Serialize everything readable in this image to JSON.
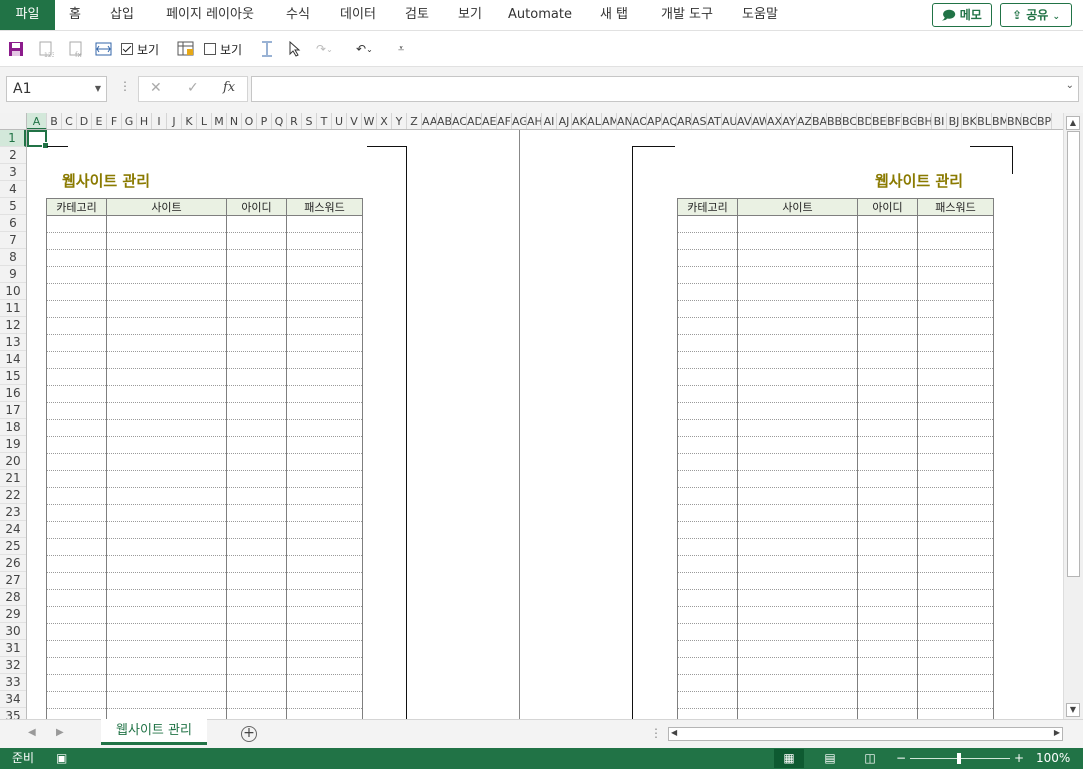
{
  "menu": {
    "tabs": [
      "파일",
      "홈",
      "삽입",
      "페이지 레이아웃",
      "수식",
      "데이터",
      "검토",
      "보기",
      "Automate",
      "새 탭",
      "개발 도구",
      "도움말"
    ],
    "memo_button": "메모",
    "share_button": "공유"
  },
  "quickbar": {
    "checkbox1_label": "보기",
    "checkbox1_checked": true,
    "checkbox2_label": "보기",
    "checkbox2_checked": false
  },
  "formula_bar": {
    "name_box": "A1",
    "formula_value": ""
  },
  "grid": {
    "column_headers": [
      "A",
      "B",
      "C",
      "D",
      "E",
      "F",
      "G",
      "H",
      "I",
      "J",
      "K",
      "L",
      "M",
      "N",
      "O",
      "P",
      "Q",
      "R",
      "S",
      "T",
      "U",
      "V",
      "W",
      "X",
      "Y",
      "Z",
      "AA",
      "AB",
      "AC",
      "AD",
      "AE",
      "AF",
      "AG",
      "AH",
      "AI",
      "AJ",
      "AK",
      "AL",
      "AM",
      "AN",
      "AO",
      "AP",
      "AQ",
      "AR",
      "AS",
      "AT",
      "AU",
      "AV",
      "AW",
      "AX",
      "AY",
      "AZ",
      "BA",
      "BB",
      "BC",
      "BD",
      "BE",
      "BF",
      "BG",
      "BH",
      "BI",
      "BJ",
      "BK",
      "BL",
      "BM",
      "BN",
      "BO",
      "BP"
    ],
    "row_headers": [
      "1",
      "2",
      "3",
      "4",
      "5",
      "6",
      "7",
      "8",
      "9",
      "10",
      "11",
      "12",
      "13",
      "14",
      "15",
      "16",
      "17",
      "18",
      "19",
      "20",
      "21",
      "22",
      "23",
      "24",
      "25",
      "26",
      "27",
      "28",
      "29",
      "30",
      "31",
      "32",
      "33",
      "34",
      "35"
    ],
    "active_cell": "A1"
  },
  "left_page": {
    "title": "웹사이트 관리",
    "headers": [
      "카테고리",
      "사이트",
      "아이디",
      "패스워드"
    ]
  },
  "right_page": {
    "title": "웹사이트 관리",
    "headers": [
      "카테고리",
      "사이트",
      "아이디",
      "패스워드"
    ]
  },
  "sheet_tabs": {
    "active": "웹사이트 관리"
  },
  "status": {
    "ready": "준비",
    "zoom": "100%"
  },
  "colors": {
    "accent": "#217346",
    "title": "#8a7a00",
    "header_fill": "#eaf1e3"
  }
}
